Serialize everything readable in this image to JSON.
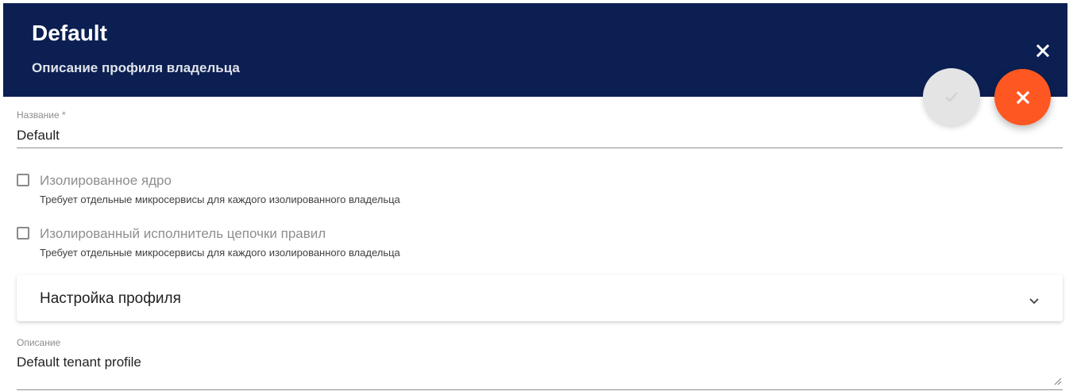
{
  "header": {
    "title": "Default",
    "subtitle": "Описание профиля владельца",
    "close_icon": "close-icon"
  },
  "actions": {
    "save_icon": "check-icon",
    "cancel_icon": "close-icon",
    "accent_color": "#ff5722",
    "disabled_color": "#e4e4e4"
  },
  "form": {
    "name": {
      "label": "Название *",
      "value": "Default"
    },
    "isolated_core": {
      "label": "Изолированное ядро",
      "hint": "Требует отдельные микросервисы для каждого изолированного владельца",
      "checked": false
    },
    "isolated_rule_chain": {
      "label": "Изолированный исполнитель цепочки правил",
      "hint": "Требует отдельные микросервисы для каждого изолированного владельца",
      "checked": false
    },
    "profile_settings": {
      "title": "Настройка профиля",
      "expanded": false,
      "icon": "chevron-down-icon"
    },
    "description": {
      "label": "Описание",
      "value": "Default tenant profile"
    }
  },
  "colors": {
    "header_background": "#0b1f52",
    "header_text": "#ffffff"
  }
}
